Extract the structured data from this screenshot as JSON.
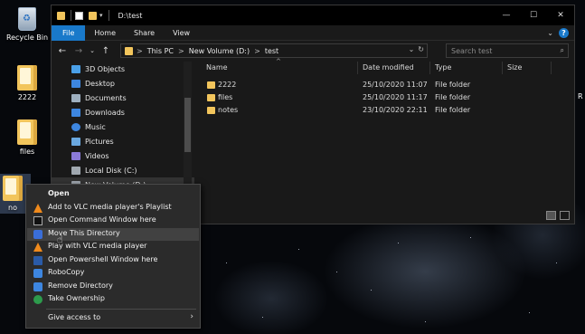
{
  "desktop": {
    "icons": [
      {
        "label": "Recycle Bin",
        "icon": "recycle-bin-icon"
      },
      {
        "label": "2222",
        "icon": "folder-icon"
      },
      {
        "label": "files",
        "icon": "folder-icon"
      },
      {
        "label": "no",
        "icon": "folder-icon"
      }
    ],
    "edge_label": "R"
  },
  "window": {
    "title": "D:\\test",
    "controls": {
      "minimize": "—",
      "maximize": "☐",
      "close": "✕"
    }
  },
  "ribbon": {
    "tabs": [
      "File",
      "Home",
      "Share",
      "View"
    ],
    "expand": "⌄",
    "help": "?"
  },
  "address": {
    "back": "←",
    "forward": "→",
    "recent": "⌄",
    "up": "↑",
    "crumbs": [
      "This PC",
      "New Volume (D:)",
      "test"
    ],
    "separator": ">",
    "dropdown": "⌄",
    "refresh": "↻",
    "search_placeholder": "Search test",
    "search_icon": "⌕"
  },
  "nav_pane": {
    "items": [
      {
        "label": "3D Objects",
        "color": "#4aa0e8"
      },
      {
        "label": "Desktop",
        "color": "#3d86e0"
      },
      {
        "label": "Documents",
        "color": "#9fb0c0"
      },
      {
        "label": "Downloads",
        "color": "#3d86e0"
      },
      {
        "label": "Music",
        "color": "#3d86e0"
      },
      {
        "label": "Pictures",
        "color": "#6aa8e0"
      },
      {
        "label": "Videos",
        "color": "#8a7ad8"
      },
      {
        "label": "Local Disk (C:)",
        "color": "#a0a8b0"
      },
      {
        "label": "New Volume (D:)",
        "color": "#a0a8b0"
      }
    ]
  },
  "file_list": {
    "columns": [
      "Name",
      "Date modified",
      "Type",
      "Size"
    ],
    "rows": [
      {
        "name": "2222",
        "date": "25/10/2020 11:07",
        "type": "File folder",
        "size": ""
      },
      {
        "name": "files",
        "date": "25/10/2020 11:17",
        "type": "File folder",
        "size": ""
      },
      {
        "name": "notes",
        "date": "23/10/2020 22:11",
        "type": "File folder",
        "size": ""
      }
    ]
  },
  "context_menu": {
    "items": [
      {
        "label": "Open",
        "icon": "none",
        "bold": true
      },
      {
        "label": "Add to VLC media player's Playlist",
        "icon": "vlc-icon"
      },
      {
        "label": "Open Command Window here",
        "icon": "command-prompt-icon"
      },
      {
        "label": "Move This Directory",
        "icon": "move-icon",
        "highlighted": true
      },
      {
        "label": "Play with VLC media player",
        "icon": "vlc-icon"
      },
      {
        "label": "Open Powershell Window here",
        "icon": "powershell-icon"
      },
      {
        "label": "RoboCopy",
        "icon": "robocopy-icon"
      },
      {
        "label": "Remove Directory",
        "icon": "remove-directory-icon"
      },
      {
        "label": "Take Ownership",
        "icon": "shield-icon"
      },
      {
        "label": "Give access to",
        "icon": "none",
        "submenu": true
      }
    ],
    "submenu_arrow": "›"
  },
  "colors": {
    "accent": "#1979ca",
    "folder": "#f2c55c",
    "vlc": "#f08a1c"
  }
}
